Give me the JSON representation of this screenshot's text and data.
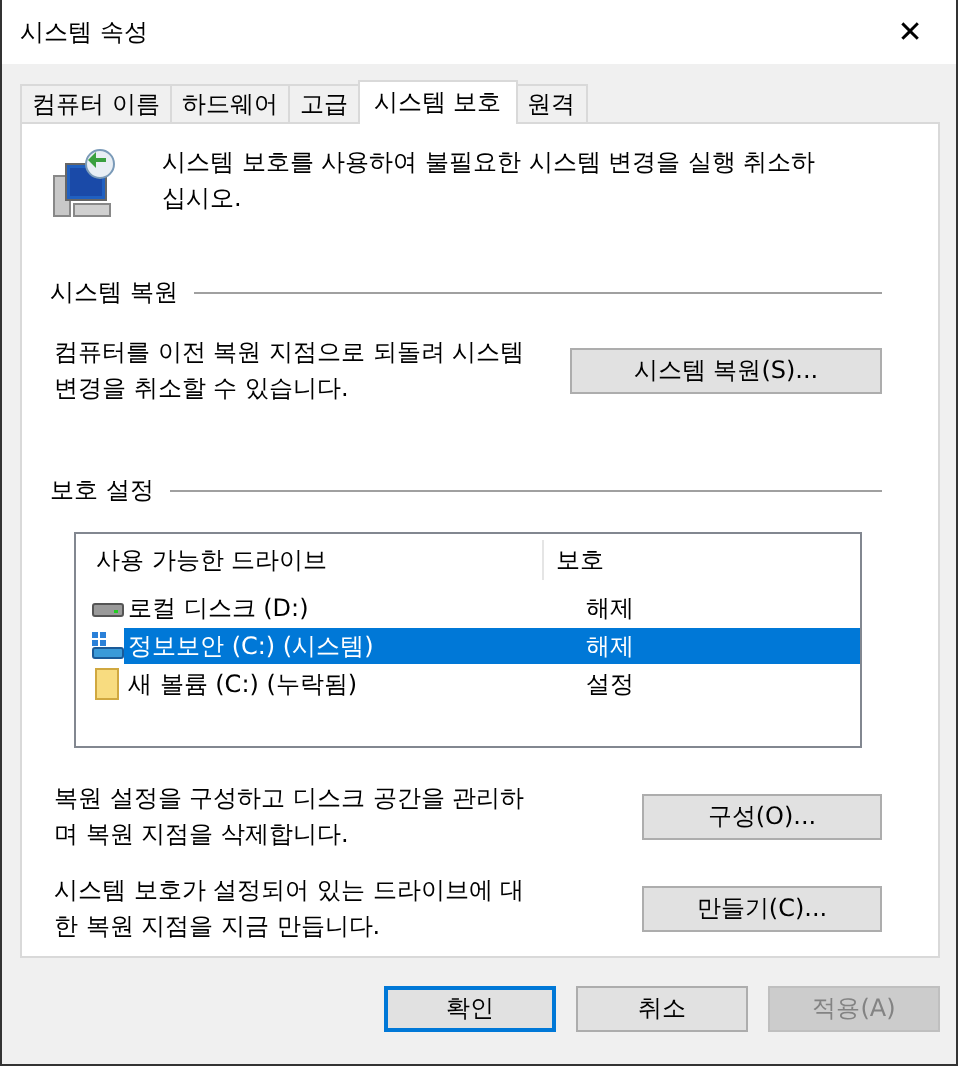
{
  "window": {
    "title": "시스템 속성",
    "close": "✕"
  },
  "tabs": [
    {
      "label": "컴퓨터 이름",
      "selected": false
    },
    {
      "label": "하드웨어",
      "selected": false
    },
    {
      "label": "고급",
      "selected": false
    },
    {
      "label": "시스템 보호",
      "selected": true
    },
    {
      "label": "원격",
      "selected": false
    }
  ],
  "intro": "시스템 보호를 사용하여 불필요한 시스템 변경을 실행 취소하십시오.",
  "restore": {
    "heading": "시스템 복원",
    "text": "컴퓨터를 이전 복원 지점으로 되돌려 시스템 변경을 취소할 수 있습니다.",
    "button": "시스템 복원(S)..."
  },
  "protection": {
    "heading": "보호 설정",
    "columns": [
      "사용 가능한 드라이브",
      "보호"
    ],
    "rows": [
      {
        "kind": "disk",
        "name": "로컬 디스크 (D:)",
        "status": "해제",
        "selected": false
      },
      {
        "kind": "system",
        "name": "정보보안 (C:) (시스템)",
        "status": "해제",
        "selected": true
      },
      {
        "kind": "folder",
        "name": "새 볼륨 (C:) (누락됨)",
        "status": "설정",
        "selected": false
      }
    ],
    "actions": [
      {
        "text": "복원 설정을 구성하고 디스크 공간을 관리하며 복원 지점을 삭제합니다.",
        "button": "구성(O)..."
      },
      {
        "text": "시스템 보호가 설정되어 있는 드라이브에 대한 복원 지점을 지금 만듭니다.",
        "button": "만들기(C)..."
      }
    ]
  },
  "buttons": [
    {
      "label": "확인",
      "kind": "default",
      "disabled": false
    },
    {
      "label": "취소",
      "kind": "normal",
      "disabled": false
    },
    {
      "label": "적용(A)",
      "kind": "normal",
      "disabled": true
    }
  ]
}
